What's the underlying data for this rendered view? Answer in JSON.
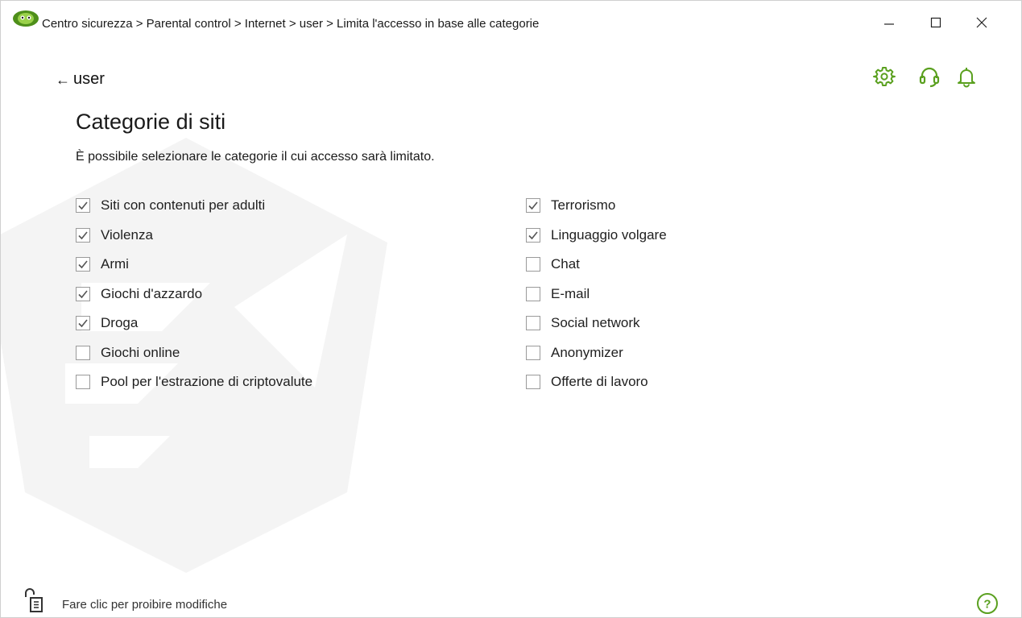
{
  "window": {
    "title": "Centro sicurezza > Parental control > Internet > user > Limita l'accesso in base alle categorie",
    "accent_color": "#5aa01f",
    "controls": {
      "minimize": "minimize-icon",
      "maximize": "maximize-icon",
      "close": "close-icon"
    }
  },
  "nav": {
    "back_arrow": "←",
    "back_label": "user"
  },
  "toolbar": {
    "icons": [
      "gear-icon",
      "headset-icon",
      "bell-icon"
    ]
  },
  "main": {
    "title": "Categorie di siti",
    "description": "È possibile selezionare le categorie il cui accesso sarà limitato.",
    "categories_left": [
      {
        "label": "Siti con contenuti per adulti",
        "checked": true
      },
      {
        "label": "Violenza",
        "checked": true
      },
      {
        "label": "Armi",
        "checked": true
      },
      {
        "label": "Giochi d'azzardo",
        "checked": true
      },
      {
        "label": "Droga",
        "checked": true
      },
      {
        "label": "Giochi online",
        "checked": false
      },
      {
        "label": "Pool per l'estrazione di criptovalute",
        "checked": false
      }
    ],
    "categories_right": [
      {
        "label": "Terrorismo",
        "checked": true
      },
      {
        "label": "Linguaggio volgare",
        "checked": true
      },
      {
        "label": "Chat",
        "checked": false
      },
      {
        "label": "E-mail",
        "checked": false
      },
      {
        "label": "Social network",
        "checked": false
      },
      {
        "label": "Anonymizer",
        "checked": false
      },
      {
        "label": "Offerte di lavoro",
        "checked": false
      }
    ]
  },
  "footer": {
    "lock_label": "Fare clic per proibire modifiche",
    "lock_icon": "unlocked-padlock-icon",
    "help_icon": "help-icon",
    "help_glyph": "?"
  }
}
